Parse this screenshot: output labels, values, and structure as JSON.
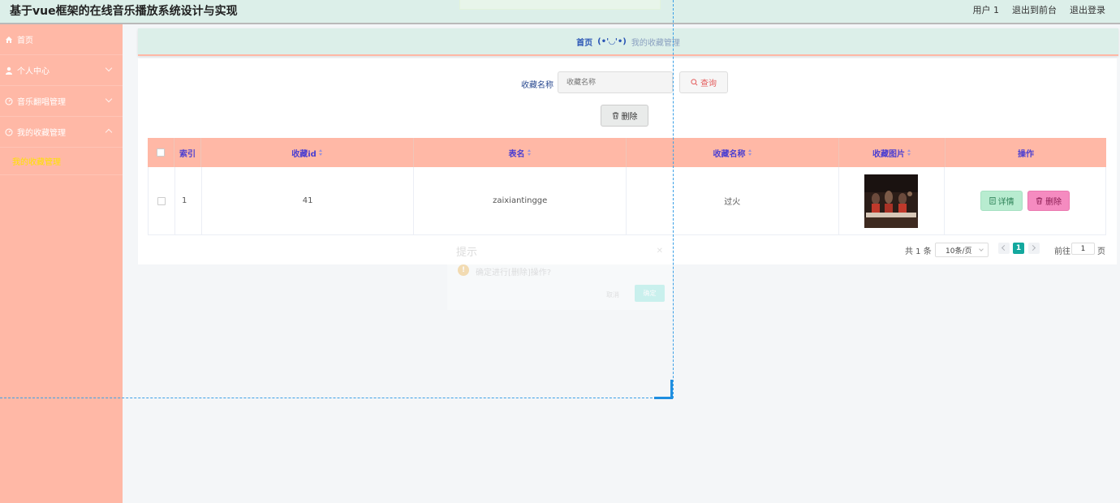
{
  "header": {
    "title": "基于vue框架的在线音乐播放系统设计与实现",
    "user": "用户 1",
    "exit_front": "退出到前台",
    "logout": "退出登录"
  },
  "sidebar": {
    "items": [
      {
        "label": "首页",
        "icon": "home-icon"
      },
      {
        "label": "个人中心",
        "icon": "user-icon"
      },
      {
        "label": "音乐翻唱管理",
        "icon": "music-icon"
      },
      {
        "label": "我的收藏管理",
        "icon": "favorite-icon"
      }
    ],
    "submenu": {
      "label": "我的收藏管理"
    }
  },
  "breadcrumb": {
    "home": "首页",
    "face": "(•'◡'•)",
    "current": "我的收藏管理"
  },
  "search": {
    "label": "收藏名称",
    "placeholder": "收藏名称",
    "button": "查询"
  },
  "toolbar": {
    "delete": "删除"
  },
  "table": {
    "columns": [
      "索引",
      "收藏id",
      "表名",
      "收藏名称",
      "收藏图片",
      "操作"
    ],
    "rows": [
      {
        "index": "1",
        "id": "41",
        "table_name": "zaixiantingge",
        "name": "过火",
        "detail": "详情",
        "delete": "删除"
      }
    ]
  },
  "pagination": {
    "total": "共 1 条",
    "page_size": "10条/页",
    "current_page": "1",
    "goto": "前往",
    "goto_value": "1",
    "page_suffix": "页"
  },
  "dialog": {
    "title": "提示",
    "message": "确定进行[删除]操作?",
    "cancel": "取消",
    "ok": "确定"
  },
  "colors": {
    "accent": "#ffb8a6",
    "header_bg": "#dcefe9",
    "active_sub": "#ffe100",
    "page_active": "#13a89e"
  }
}
